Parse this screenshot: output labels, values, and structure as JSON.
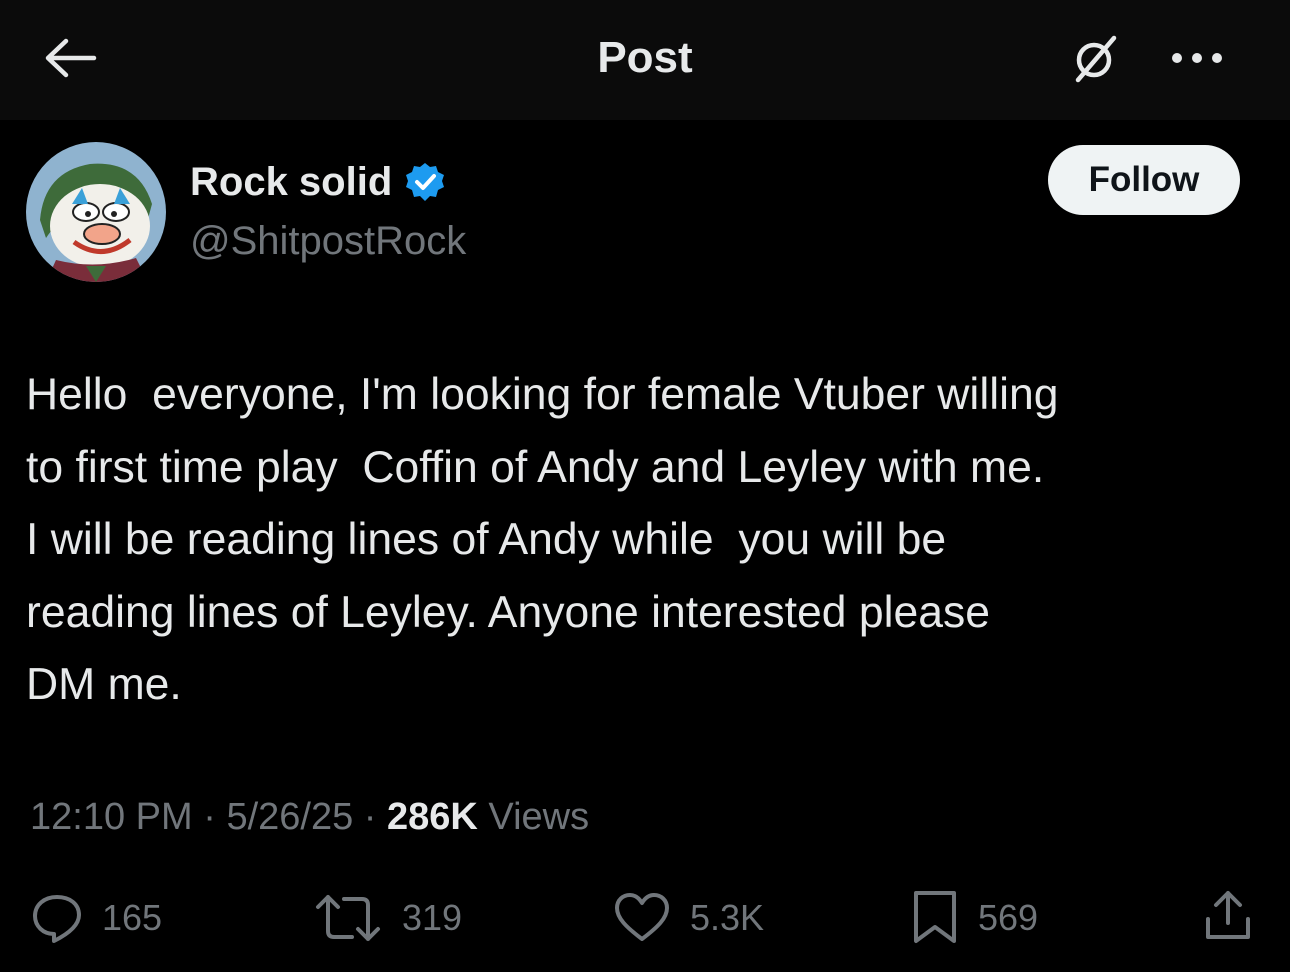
{
  "header": {
    "title": "Post",
    "back_icon": "arrow-left-icon",
    "grok_icon": "grok-icon",
    "more_icon": "more-horizontal-icon"
  },
  "author": {
    "display_name": "Rock solid",
    "handle": "@ShitpostRock",
    "verified": true,
    "verified_color": "#1d9bf0",
    "follow_label": "Follow"
  },
  "post": {
    "text": "Hello  everyone, I'm looking for female Vtuber willing\nto first time play  Coffin of Andy and Leyley with me.\nI will be reading lines of Andy while  you will be\nreading lines of Leyley. Anyone interested please\nDM me."
  },
  "meta": {
    "time": "12:10 PM",
    "separator": "·",
    "date": "5/26/25",
    "views_count": "286K",
    "views_label": "Views"
  },
  "actions": {
    "replies": "165",
    "reposts": "319",
    "likes": "5.3K",
    "bookmarks": "569",
    "reply_icon": "reply-icon",
    "repost_icon": "repost-icon",
    "like_icon": "heart-icon",
    "bookmark_icon": "bookmark-icon",
    "share_icon": "share-icon"
  },
  "colors": {
    "background": "#000000",
    "header_bg": "#0b0b0b",
    "primary_text": "#e7e9ea",
    "secondary_text": "#71767b",
    "follow_bg": "#eff3f4"
  }
}
